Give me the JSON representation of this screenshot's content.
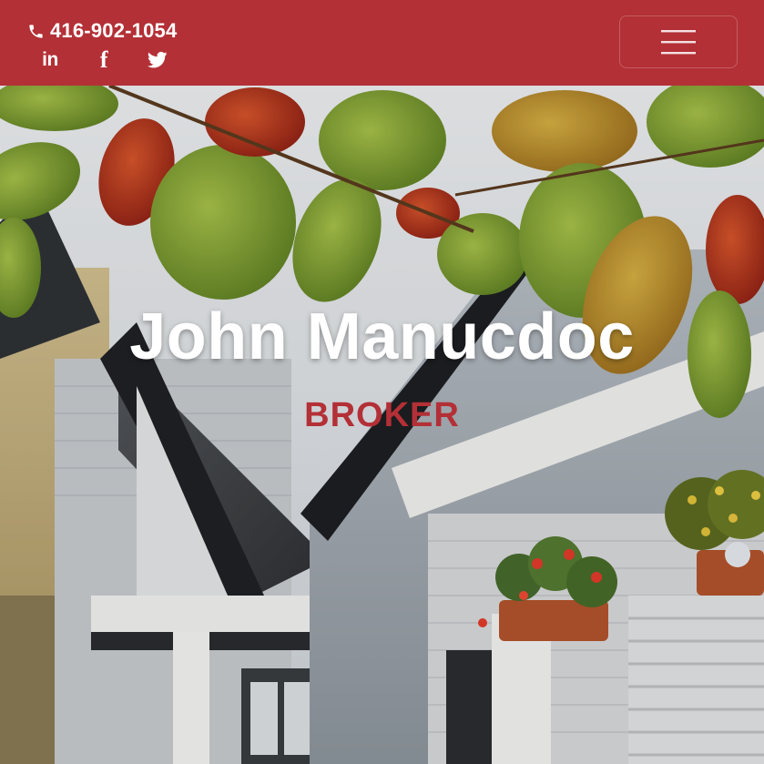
{
  "header": {
    "phone": "416-902-1054",
    "socials": [
      {
        "icon": "linkedin-icon",
        "text": "in"
      },
      {
        "icon": "facebook-icon",
        "text": "f"
      },
      {
        "icon": "twitter-icon",
        "text": ""
      }
    ],
    "menu_icon": "hamburger-menu-icon"
  },
  "hero": {
    "name": "John Manucdoc",
    "title": "BROKER",
    "background": "houses-with-autumn-leaves-photo"
  },
  "colors": {
    "brand": "#b33036",
    "text_light": "#ffffff"
  }
}
